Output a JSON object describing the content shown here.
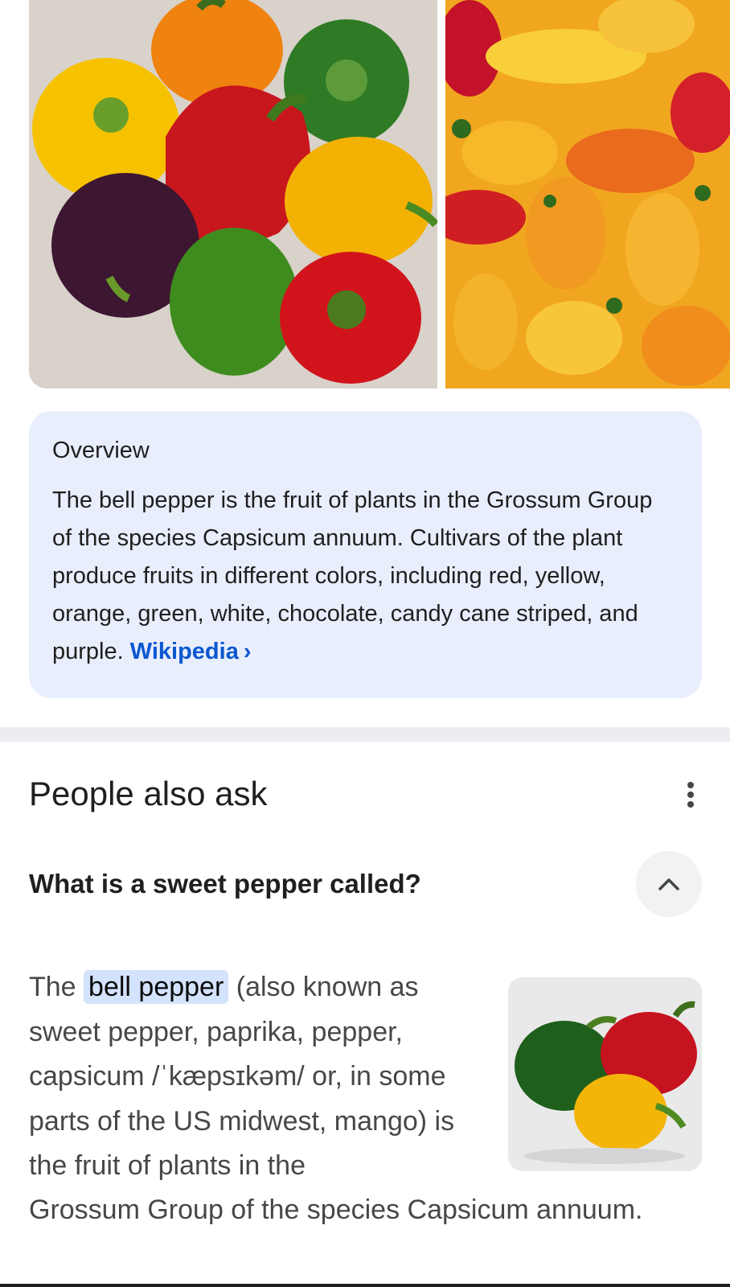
{
  "images": {
    "tile_1_name": "bell-peppers-photo",
    "tile_2_name": "mini-sweet-peppers-photo"
  },
  "overview": {
    "title": "Overview",
    "text": "The bell pepper is the fruit of plants in the Grossum Group of the species Capsicum annuum. Cultivars of the plant produce fruits in different colors, including red, yellow, orange, green, white, chocolate, candy cane striped, and purple.",
    "source_label": "Wikipedia",
    "source_chevron": "›",
    "link_color": "#0b57d0",
    "card_color": "#e8eefc"
  },
  "people_also_ask": {
    "title": "People also ask",
    "menu_icon": "more-vert-icon",
    "question": "What is a sweet pepper called?",
    "toggle_icon": "chevron-up-icon",
    "answer_pre": "The ",
    "answer_highlight": "bell pepper",
    "answer_post": " (also known as sweet pepper, paprika, pepper, capsicum /ˈkæpsɪkəm/ or, in some parts of the US midwest, mango) is the fruit of plants in the",
    "answer_tail": "Grossum Group of the species Capsicum annuum.",
    "highlight_color": "#d3e3fd"
  }
}
